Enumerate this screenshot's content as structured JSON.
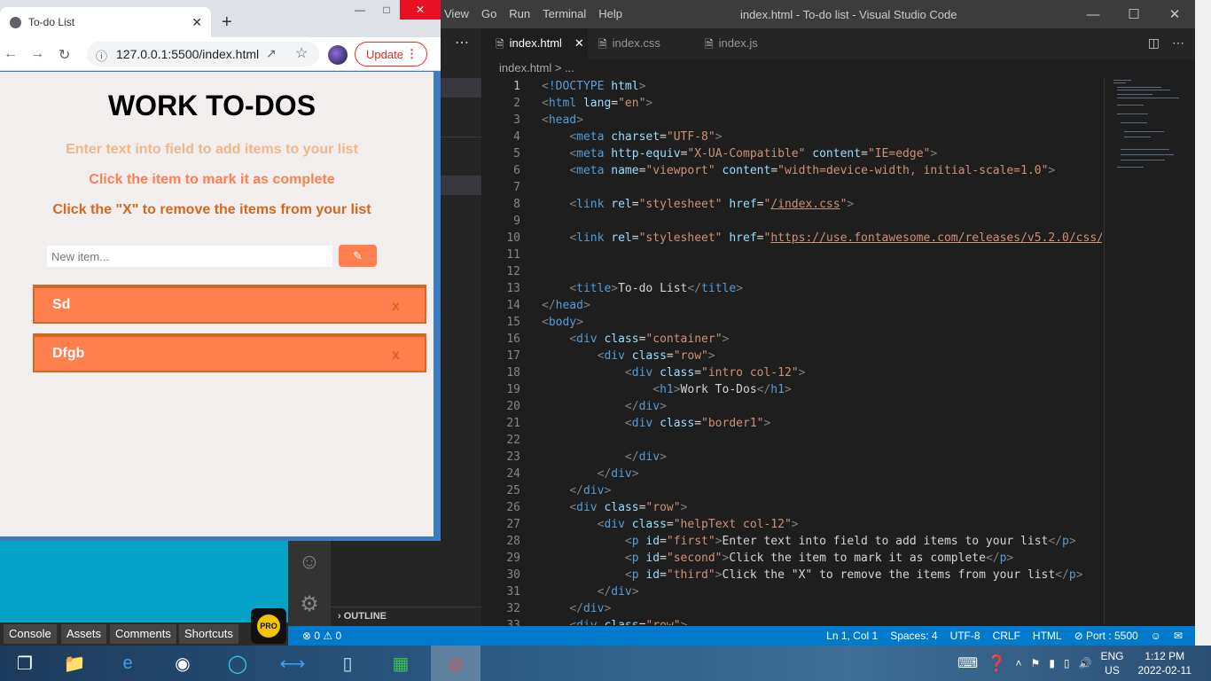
{
  "vscode": {
    "menu": [
      "View",
      "Go",
      "Run",
      "Terminal",
      "Help"
    ],
    "window_title": "index.html - To-do list - Visual Studio Code",
    "tabs": [
      {
        "label": "index.html",
        "active": true
      },
      {
        "label": "index.css",
        "active": false
      },
      {
        "label": "index.js",
        "active": false
      }
    ],
    "breadcrumb": "index.html > ...",
    "outline_label": "OUTLINE",
    "status": {
      "problems": "⊗ 0 ⚠ 0",
      "position": "Ln 1, Col 1",
      "spaces": "Spaces: 4",
      "encoding": "UTF-8",
      "eol": "CRLF",
      "language": "HTML",
      "port": "⊘ Port : 5500"
    },
    "line_numbers": [
      "1",
      "2",
      "3",
      "4",
      "5",
      "6",
      "7",
      "8",
      "9",
      "10",
      "11",
      "12",
      "13",
      "14",
      "15",
      "16",
      "17",
      "18",
      "19",
      "20",
      "21",
      "22",
      "23",
      "24",
      "25",
      "26",
      "27",
      "28",
      "29",
      "30",
      "31",
      "32",
      "33"
    ]
  },
  "browser": {
    "tab_title": "To-do List",
    "url": "127.0.0.1:5500/index.html",
    "update_label": "Update",
    "page": {
      "heading": "WORK TO-DOS",
      "help1": "Enter text into field to add items to your list",
      "help2": "Click the item to mark it as complete",
      "help3": "Click the \"X\" to remove the items from your list",
      "input_placeholder": "New item...",
      "items": [
        {
          "label": "Sd",
          "delete": "x"
        },
        {
          "label": "Dfgb",
          "delete": "x"
        }
      ],
      "colors": {
        "item_bg": "#ff7f4f",
        "item_border": "#d2691e",
        "page_bg": "#f2eeee"
      }
    }
  },
  "bottom_bar": [
    "Console",
    "Assets",
    "Comments",
    "Shortcuts"
  ],
  "pro_badge": "PRO",
  "taskbar": {
    "lang1": "ENG",
    "lang2": "US",
    "time": "1:12 PM",
    "date": "2022-02-11"
  }
}
